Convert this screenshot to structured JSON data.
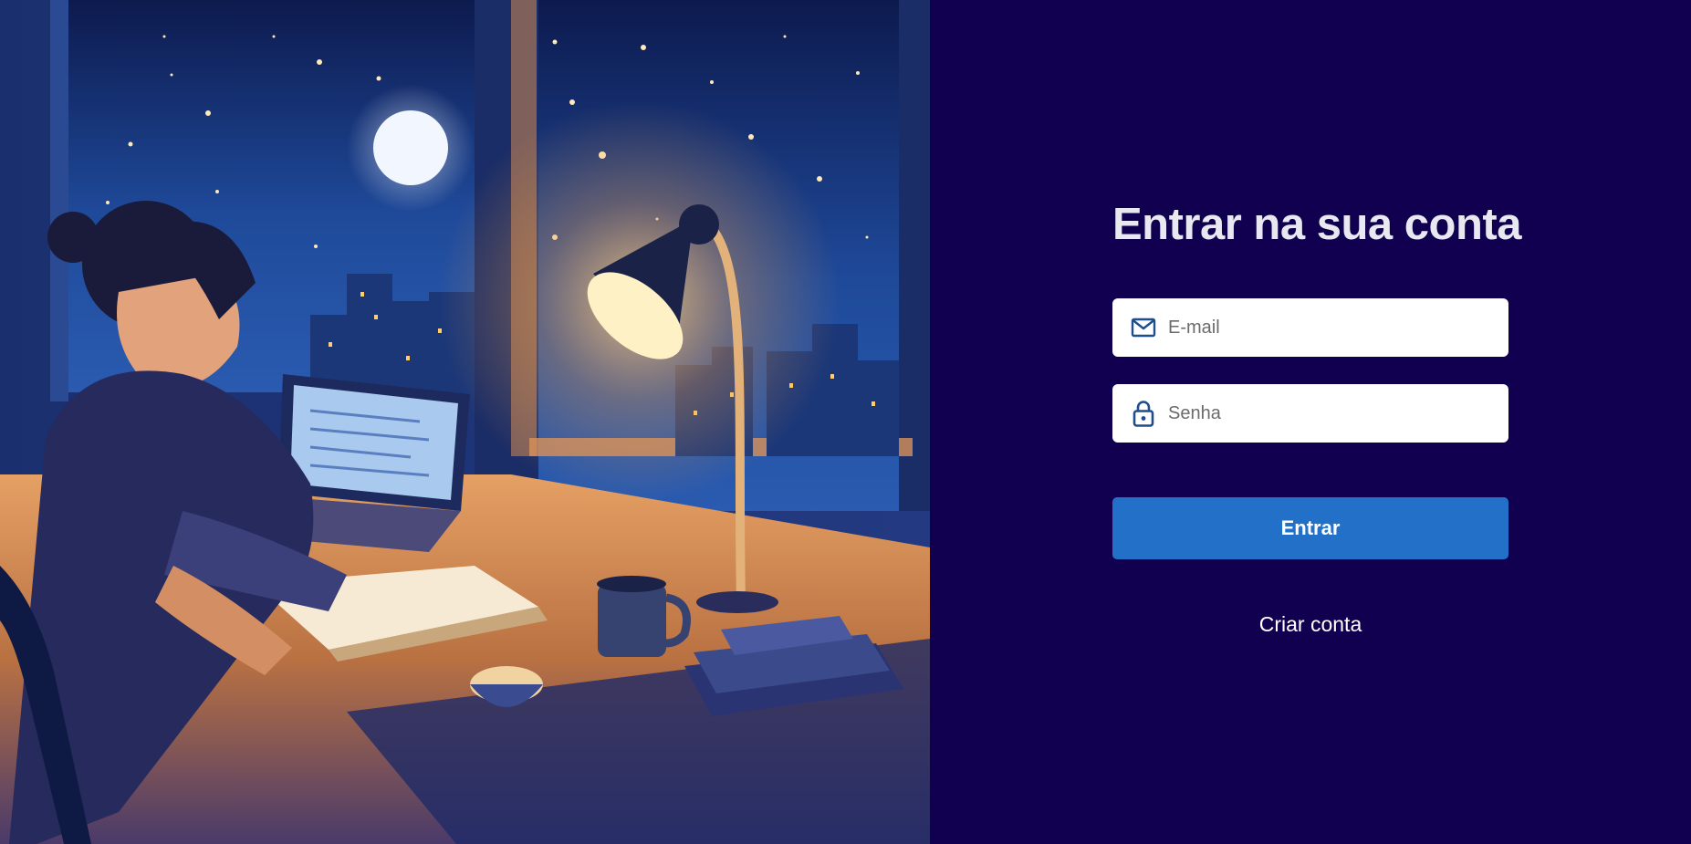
{
  "login": {
    "title": "Entrar na sua conta",
    "email": {
      "placeholder": "E-mail",
      "value": "",
      "icon": "envelope-icon"
    },
    "password": {
      "placeholder": "Senha",
      "value": "",
      "icon": "lock-icon"
    },
    "submit_label": "Entrar",
    "create_account_label": "Criar conta"
  },
  "illustration": {
    "subject": "woman studying at desk by window at night with lamp and laptop"
  },
  "colors": {
    "panel_background": "#10004f",
    "primary_button": "#2270c8",
    "title_text": "#e8e8f0",
    "input_icon": "#1f4e8f"
  }
}
